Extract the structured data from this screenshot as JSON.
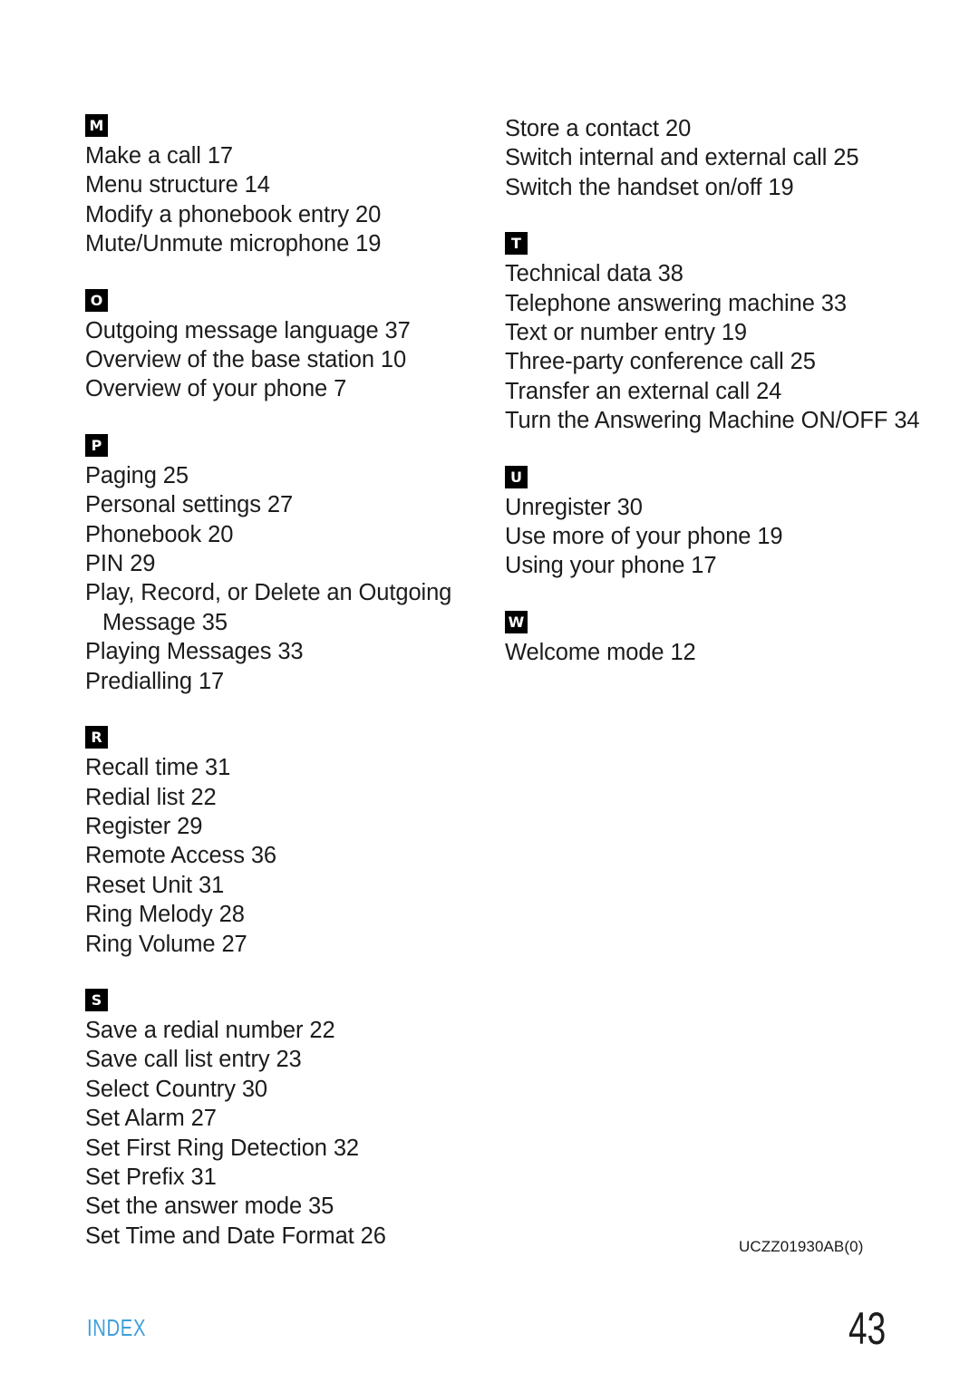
{
  "document": {
    "footer_label": "INDEX",
    "page_number": "43",
    "doc_code": "UCZZ01930AB(0)",
    "accent_color": "#3f9fda",
    "badge_bg_color": "#000000",
    "badge_text_color": "#ffffff"
  },
  "left_column": {
    "sections": [
      {
        "letter": "M",
        "entries": [
          {
            "text": "Make a call 17"
          },
          {
            "text": "Menu structure 14"
          },
          {
            "text": "Modify a phonebook entry 20"
          },
          {
            "text": "Mute/Unmute microphone 19"
          }
        ]
      },
      {
        "letter": "O",
        "entries": [
          {
            "text": "Outgoing message language 37"
          },
          {
            "text": "Overview of the base station 10"
          },
          {
            "text": "Overview of your phone 7"
          }
        ]
      },
      {
        "letter": "P",
        "entries": [
          {
            "text": "Paging 25"
          },
          {
            "text": "Personal settings 27"
          },
          {
            "text": "Phonebook 20"
          },
          {
            "text": "PIN 29"
          },
          {
            "text": "Play, Record, or Delete an Outgoing",
            "continuation": "Message 35"
          },
          {
            "text": "Playing Messages 33"
          },
          {
            "text": "Predialling 17"
          }
        ]
      },
      {
        "letter": "R",
        "entries": [
          {
            "text": "Recall time 31"
          },
          {
            "text": "Redial list 22"
          },
          {
            "text": "Register 29"
          },
          {
            "text": "Remote Access 36"
          },
          {
            "text": "Reset Unit 31"
          },
          {
            "text": "Ring Melody 28"
          },
          {
            "text": "Ring Volume 27"
          }
        ]
      },
      {
        "letter": "S",
        "entries": [
          {
            "text": "Save a redial number 22"
          },
          {
            "text": "Save call list entry 23"
          },
          {
            "text": "Select Country 30"
          },
          {
            "text": "Set Alarm 27"
          },
          {
            "text": "Set First Ring Detection 32"
          },
          {
            "text": "Set Prefix 31"
          },
          {
            "text": "Set the answer mode 35"
          },
          {
            "text": "Set Time and Date Format 26"
          }
        ]
      }
    ]
  },
  "right_column": {
    "sections": [
      {
        "letter": "",
        "continued_from": "S",
        "entries": [
          {
            "text": "Store a contact 20"
          },
          {
            "text": "Switch internal and external call 25"
          },
          {
            "text": "Switch the handset on/off 19"
          }
        ]
      },
      {
        "letter": "T",
        "entries": [
          {
            "text": "Technical data 38"
          },
          {
            "text": "Telephone answering machine 33"
          },
          {
            "text": "Text or number entry 19"
          },
          {
            "text": "Three-party conference call 25"
          },
          {
            "text": "Transfer an external call 24"
          },
          {
            "text": "Turn the Answering Machine ON/OFF 34"
          }
        ]
      },
      {
        "letter": "U",
        "entries": [
          {
            "text": "Unregister 30"
          },
          {
            "text": "Use more of your phone 19"
          },
          {
            "text": "Using your phone 17"
          }
        ]
      },
      {
        "letter": "W",
        "entries": [
          {
            "text": "Welcome mode 12"
          }
        ]
      }
    ]
  }
}
